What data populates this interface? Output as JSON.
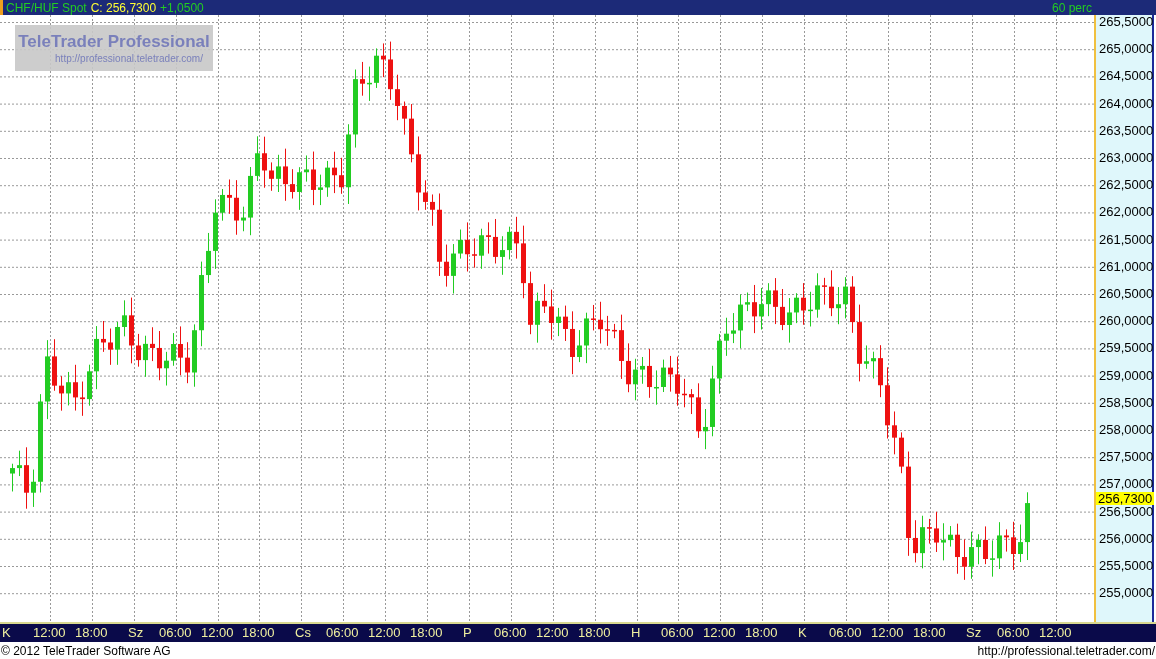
{
  "header": {
    "symbol": "CHF/HUF Spot",
    "close": "C: 256,7300",
    "change": "+1,0500",
    "interval": "60 perc"
  },
  "logo": {
    "title": "TeleTrader Professional",
    "url": "http://professional.teletrader.com/"
  },
  "y_axis": {
    "labels": [
      "265,5000",
      "265,0000",
      "264,5000",
      "264,0000",
      "263,5000",
      "263,0000",
      "262,5000",
      "262,0000",
      "261,5000",
      "261,0000",
      "260,5000",
      "260,0000",
      "259,5000",
      "259,0000",
      "258,5000",
      "258,0000",
      "257,5000",
      "257,0000",
      "256,5000",
      "256,0000",
      "255,5000",
      "255,0000"
    ],
    "price_tag": "256,7300"
  },
  "x_axis": {
    "labels": [
      "K",
      "12:00",
      "18:00",
      "Sz",
      "06:00",
      "12:00",
      "18:00",
      "Cs",
      "06:00",
      "12:00",
      "18:00",
      "P",
      "06:00",
      "12:00",
      "18:00",
      "H",
      "06:00",
      "12:00",
      "18:00",
      "K",
      "06:00",
      "12:00",
      "18:00",
      "Sz",
      "06:00",
      "12:00"
    ]
  },
  "footer": {
    "copyright": "© 2012 TeleTrader Software AG",
    "url": "http://professional.teletrader.com/"
  }
}
